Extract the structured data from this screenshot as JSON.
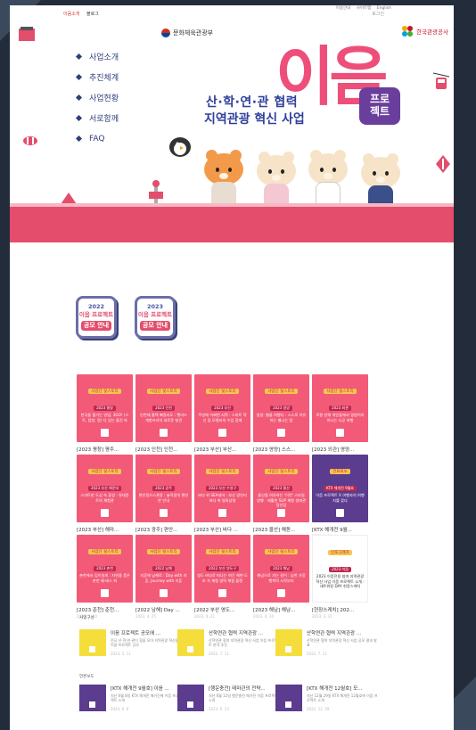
{
  "topbar": {
    "links": [
      "이음소개",
      "블로그"
    ],
    "login": "로그인",
    "util": [
      "이용안내",
      "사이트맵",
      "English"
    ]
  },
  "header": {
    "ministry": "문화체육관광부",
    "kto": "한국관광공사"
  },
  "nav": [
    "사업소개",
    "추진체계",
    "사업현황",
    "서로함께",
    "FAQ"
  ],
  "hero": {
    "sub1": "산·학·연·관 협력",
    "sub2": "지역관광 혁신 사업",
    "title": "이음",
    "badge1": "프로",
    "badge2": "젝트"
  },
  "promos": [
    {
      "year": "2022",
      "name": "이음 프로젝트",
      "label": "공모 안내"
    },
    {
      "year": "2023",
      "name": "이음 프로젝트",
      "label": "공모 안내"
    }
  ],
  "cards": [
    {
      "tag": "사업단 뒷스토리",
      "yr": "2023 평창",
      "desc": "한국을 즐기는 방법, 3GO! (스트, 탐방, 맛) 다 있는 울진 하",
      "title": "[2023 평창] 평주...",
      "date": "2023. 6. 20",
      "style": "pink"
    },
    {
      "tag": "사업단 뒷스토리",
      "yr": "2023 인천",
      "desc": "인천에 콜택 빠질지도 : 펫러드 개항커리의 새로운 발견",
      "title": "[2023 인천] 인천...",
      "date": "2023. 6. 15",
      "style": "pink"
    },
    {
      "tag": "사업단 뒷스토리",
      "yr": "2023 부산",
      "desc": "주방에 어쩌면 서학 : 스마트 혁신 및 모델리의 수업 함께",
      "title": "[2023 부산] 부산...",
      "date": "2023. 6. 9",
      "style": "pink"
    },
    {
      "tag": "사업단 뒷스토리",
      "yr": "2023 영양",
      "desc": "영양, 별을 여행다 : 스스로 치유하는 별나는 밤",
      "title": "[2023 영양] 스스...",
      "date": "2023. 6. 16",
      "style": "pink"
    },
    {
      "tag": "사업단 뒷스토리",
      "yr": "2023 외관",
      "desc": "로컬 만해 개인들에서 영양이의 하나는 시공 여행",
      "title": "[2023 외관] 영양...",
      "date": "2023. 6. 12",
      "style": "pink"
    },
    {
      "tag": "사업단 뒷스토리",
      "yr": "2023 부산 해운대",
      "desc": "스마트한 도심 속 휴양 : 뮤대윤트의 체험관",
      "title": "[2023 부산] 해마...",
      "date": "2023. 6. 8",
      "style": "pink"
    },
    {
      "tag": "사업단 뒷스토리",
      "yr": "2023 광주",
      "desc": "편안함으스관광 : 슐적광의 편안한 안내",
      "title": "[2023 광주] 편안...",
      "date": "2023. 6. 2",
      "style": "pink"
    },
    {
      "tag": "사업단 뒷스토리",
      "yr": "2023 부산 수영구",
      "desc": "바다 위 SEA네마 : 부산 광안리 바다 위 영화상영",
      "title": "[2023 부산] 바다 ...",
      "date": "2023. 5. 30",
      "style": "pink"
    },
    {
      "tag": "사업단 뒷스토리",
      "yr": "2023 울산",
      "desc": "울산을 여유하는 '이런' 스타일 양행 : 제활한 SUP 체험 생태관광산업",
      "title": "[2023 울산] 해돋...",
      "date": "2023. 5. 26",
      "style": "pink"
    },
    {
      "tag": "전화회보",
      "yr": "KTX 해개전 9월호",
      "desc": "이음 프로젝트 X 여행자의 여행지를 찾다",
      "title": "[KTX 해개전 9월...",
      "date": "2023. 1. 30",
      "style": "purple"
    },
    {
      "tag": "사업단 뒷스토리",
      "yr": "2023 춘천",
      "desc": "춘천에서 김이실게 : 자연을 품은 춘천 쉐-테스 파",
      "title": "[2023 춘천] 춘천...",
      "date": "2023. 5. 10",
      "style": "pink"
    },
    {
      "tag": "사업단 뒷스토리",
      "yr": "2022 남해",
      "desc": "지혼에 남해로 : Day with 지혼, Journey with 지혼",
      "title": "[2022 남해] Day ...",
      "date": "2023. 4. 25",
      "style": "pink"
    },
    {
      "tag": "사업단 뒷스토리",
      "yr": "2022 부산 영도구",
      "desc": "영도 바다로 떠나는 여긴 해변 도보 속 체험 영역 체험 플랜",
      "title": "[2022 부산 영도...",
      "date": "2023. 4. 21",
      "style": "pink"
    },
    {
      "tag": "사업단 뒷스토리",
      "yr": "2023 해남",
      "desc": "해남으로 가는 걸어 : 남한 가장 행복의 시작부터",
      "title": "[2023 해남] 해남...",
      "date": "2023. 4. 14",
      "style": "pink"
    },
    {
      "tag": "인포그래프",
      "yr": "2023 이음",
      "desc": "2023 이음전용 참여 지역관광 혁신 사업 이음 프로젝트 소개 : 새트워킹 DAY 현장스케치",
      "title": "[현장스케치] 202...",
      "date": "2023. 3. 31",
      "style": "white"
    }
  ],
  "sections": {
    "press": "사업구성",
    "etc": "언론보도"
  },
  "news": [
    {
      "title": "이음 프로젝트 공모에 ...",
      "desc": "전국 산·학·연·관이 힘을 모아 지역관광 혁신을 이끌 프로젝트 공모",
      "date": "2023. 5. 11",
      "style": "yellow"
    },
    {
      "title": "산학연관 협력 지역관광 ...",
      "desc": "산학연관 협력 지역관광 혁신 사업 이음 프로젝트 본격 추진",
      "date": "2022. 7. 11",
      "style": "yellow"
    },
    {
      "title": "산학연관 협력 지역관광 ...",
      "desc": "산학연관 협력 지역관광 혁신 사업 공모 결과 발표",
      "date": "2022. 7. 11",
      "style": "yellow"
    },
    {
      "title": "[KTX 해개전 9월호] 이음 ...",
      "desc": "지난 6월 8일 KTX 해개전 매거진에 이음 프로젝트 소개",
      "date": "2023. 6. 9",
      "style": "purple"
    },
    {
      "title": "[행운충전] 테마관의 전략...",
      "desc": "지난 6월 12일 행운충전 매거진 이음 프로젝트 소개",
      "date": "2023. 6. 13",
      "style": "purple"
    },
    {
      "title": "[KTX 해개전 12월호] 모...",
      "desc": "지난 12월 29일 KTX 해개전 12월호에 이음 프로젝트 소개",
      "date": "2022. 12. 29",
      "style": "purple"
    }
  ],
  "colors": {
    "pink": "#e44d6c",
    "navy": "#2f3f7a",
    "purple": "#5b3c8f",
    "yellow": "#f5de3c"
  }
}
